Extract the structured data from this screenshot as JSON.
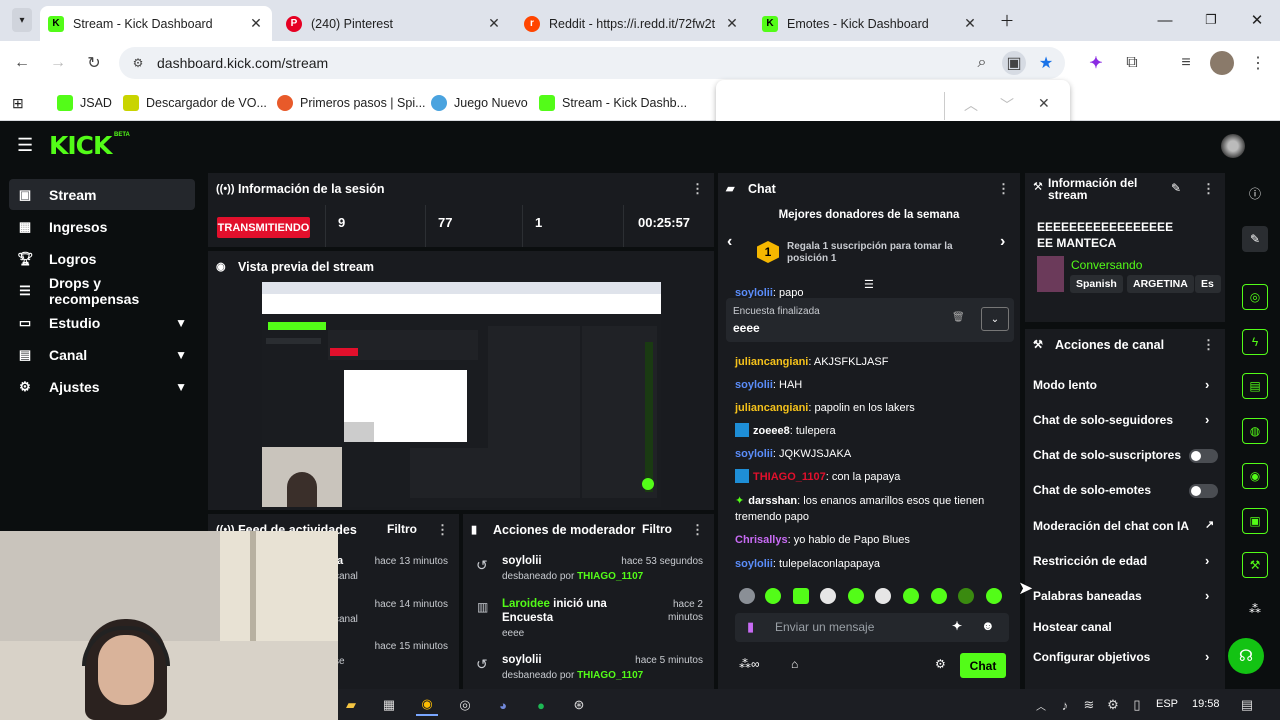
{
  "browser": {
    "tabs": [
      {
        "title": "Stream - Kick Dashboard"
      },
      {
        "title": "(240) Pinterest"
      },
      {
        "title": "Reddit - https://i.redd.it/72fw2t"
      },
      {
        "title": "Emotes - Kick Dashboard"
      }
    ],
    "url": "dashboard.kick.com/stream",
    "bookmarks": [
      {
        "label": "JSAD"
      },
      {
        "label": "Descargador de VO..."
      },
      {
        "label": "Primeros pasos | Spi..."
      },
      {
        "label": "Juego Nuevo"
      },
      {
        "label": "Stream - Kick Dashb..."
      }
    ]
  },
  "kick": {
    "logo": "KICK",
    "beta": "BETA"
  },
  "sidebar": {
    "items": [
      {
        "label": "Stream"
      },
      {
        "label": "Ingresos"
      },
      {
        "label": "Logros"
      },
      {
        "label": "Drops y recompensas"
      },
      {
        "label": "Estudio"
      },
      {
        "label": "Canal"
      },
      {
        "label": "Ajustes"
      }
    ]
  },
  "session": {
    "title": "Información de la sesión",
    "live_badge": "TRANSMITIENDO",
    "stats": [
      "9",
      "77",
      "1",
      "00:25:57"
    ]
  },
  "preview": {
    "title": "Vista previa del stream"
  },
  "feed": {
    "title": "Feed de actividades",
    "filter": "Filtro",
    "items": [
      {
        "name": "la",
        "sub": "canal",
        "time": "hace 13 minutos"
      },
      {
        "name": "",
        "sub": "canal",
        "time": "hace 14 minutos"
      },
      {
        "name": "",
        "sub": "se",
        "time": "hace 15 minutos"
      }
    ]
  },
  "moderator": {
    "title": "Acciones de moderador",
    "filter": "Filtro",
    "items": [
      {
        "user": "soylolii",
        "action": "desbaneado por",
        "by": "THIAGO_1107",
        "time": "hace 53 segundos"
      },
      {
        "user": "Laroidee",
        "action": "inició una Encuesta",
        "extra": "eeee",
        "time": "hace 2 minutos"
      },
      {
        "user": "soylolii",
        "action": "desbaneado por",
        "by": "THIAGO_1107",
        "time": "hace 5 minutos"
      }
    ]
  },
  "chat": {
    "title": "Chat",
    "donors_title": "Mejores donadores de la semana",
    "donor_rank": "1",
    "donor_text": "Regala 1 suscripción para tomar la posición 1",
    "partial_line": {
      "user": "soylolii",
      "text": "papo"
    },
    "poll_label": "Encuesta finalizada",
    "poll_value": "eeee",
    "messages": [
      {
        "user": "juliancangiani",
        "text": "AKJSFKLJASF",
        "color": "#f5c21b"
      },
      {
        "user": "soylolii",
        "text": "HAH",
        "color": "#5b8dfa"
      },
      {
        "user": "juliancangiani",
        "text": "papolin en los lakers",
        "color": "#f5c21b"
      },
      {
        "user": "zoeee8",
        "text": "tulepera",
        "color": "#ffffff"
      },
      {
        "user": "soylolii",
        "text": "JQKWJSJAKA",
        "color": "#5b8dfa"
      },
      {
        "user": "THIAGO_1107",
        "text": "con la papaya",
        "color": "#e2102c"
      },
      {
        "user": "darsshan",
        "text": "los enanos amarillos esos que tienen tremendo papo",
        "color": "#ffffff"
      },
      {
        "user": "Chrisallys",
        "text": "yo hablo de Papo Blues",
        "color": "#c86bf4"
      },
      {
        "user": "soylolii",
        "text": "tulepelaconlapapaya",
        "color": "#5b8dfa"
      }
    ],
    "input_placeholder": "Enviar un mensaje",
    "send_label": "Chat"
  },
  "stream_info": {
    "title": "Información del stream",
    "stream_title": "EEEEEEEEEEEEEEEEEEE MANTECA",
    "category": "Conversando",
    "tags": [
      "Spanish",
      "ARGETINA",
      "Es"
    ]
  },
  "channel_actions": {
    "title": "Acciones de canal",
    "items": [
      {
        "label": "Modo lento",
        "type": "chevron"
      },
      {
        "label": "Chat de solo-seguidores",
        "type": "chevron"
      },
      {
        "label": "Chat de solo-suscriptores",
        "type": "toggle"
      },
      {
        "label": "Chat de solo-emotes",
        "type": "toggle"
      },
      {
        "label": "Moderación del chat con IA",
        "type": "external"
      },
      {
        "label": "Restricción de edad",
        "type": "chevron"
      },
      {
        "label": "Palabras baneadas",
        "type": "chevron"
      },
      {
        "label": "Hostear canal",
        "type": "none"
      },
      {
        "label": "Configurar objetivos",
        "type": "chevron"
      }
    ]
  },
  "taskbar": {
    "lang": "ESP",
    "time": "19:58"
  },
  "colors": {
    "accent": "#53fc18",
    "live": "#e2102c",
    "panel": "#191b1f",
    "bg": "#0b0e0f"
  }
}
